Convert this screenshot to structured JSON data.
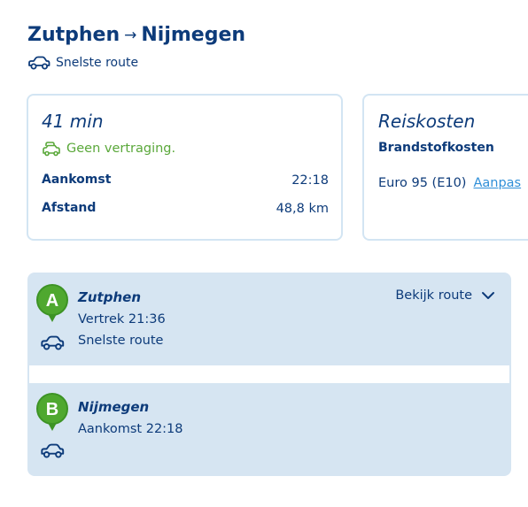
{
  "header": {
    "from": "Zutphen",
    "arrow": "→",
    "to": "Nijmegen",
    "route_type": "Snelste route"
  },
  "summary": {
    "duration": "41 min",
    "delay_status": "Geen vertraging.",
    "arrival_label": "Aankomst",
    "arrival_value": "22:18",
    "distance_label": "Afstand",
    "distance_value": "48,8 km"
  },
  "costs": {
    "title": "Reiskosten",
    "fuel_heading": "Brandstofkosten",
    "fuel_type": "Euro 95 (E10)",
    "edit_link": "Aanpas"
  },
  "route": {
    "view_route_label": "Bekijk route",
    "start": {
      "marker": "A",
      "name": "Zutphen",
      "info": "Vertrek 21:36",
      "route_type": "Snelste route"
    },
    "end": {
      "marker": "B",
      "name": "Nijmegen",
      "info": "Aankomst 22:18"
    }
  },
  "colors": {
    "primary": "#0d3b7a",
    "success": "#5aa83a",
    "marker_green": "#4fa82f",
    "link": "#2f8fd8",
    "panel": "#d6e5f2",
    "border": "#d3e5f3"
  },
  "icons": [
    "car-icon",
    "car-traffic-icon",
    "marker-a-icon",
    "marker-b-icon",
    "chevron-down-icon"
  ]
}
